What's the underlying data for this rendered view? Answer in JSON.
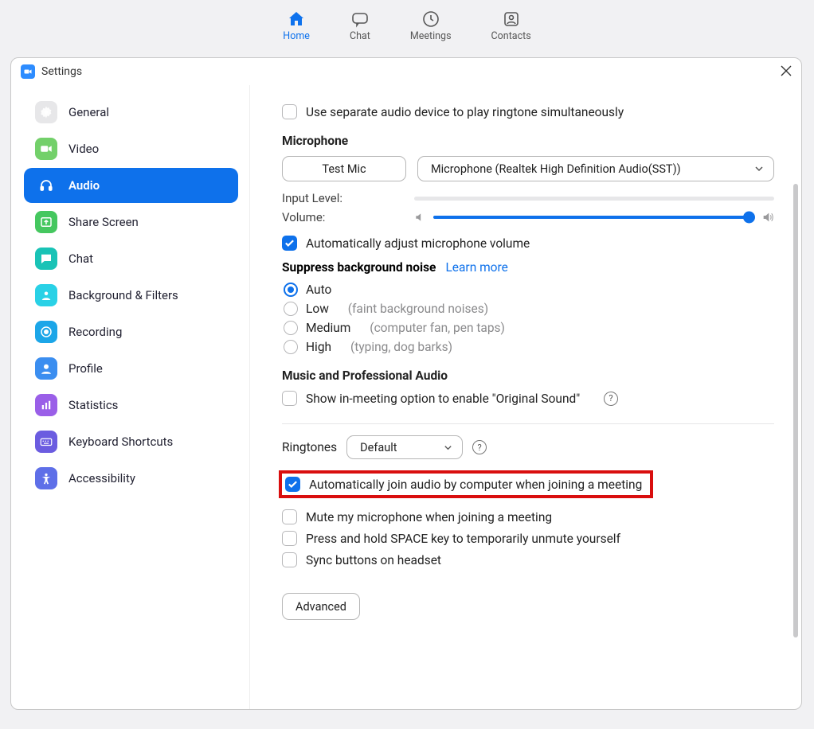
{
  "topnav": {
    "home": "Home",
    "chat": "Chat",
    "meetings": "Meetings",
    "contacts": "Contacts"
  },
  "window": {
    "title": "Settings"
  },
  "sidebar": {
    "items": [
      {
        "label": "General"
      },
      {
        "label": "Video"
      },
      {
        "label": "Audio"
      },
      {
        "label": "Share Screen"
      },
      {
        "label": "Chat"
      },
      {
        "label": "Background & Filters"
      },
      {
        "label": "Recording"
      },
      {
        "label": "Profile"
      },
      {
        "label": "Statistics"
      },
      {
        "label": "Keyboard Shortcuts"
      },
      {
        "label": "Accessibility"
      }
    ]
  },
  "audio": {
    "separate_device": "Use separate audio device to play ringtone simultaneously",
    "microphone_title": "Microphone",
    "test_mic": "Test Mic",
    "mic_device": "Microphone (Realtek High Definition Audio(SST))",
    "input_level": "Input Level:",
    "volume": "Volume:",
    "auto_adjust": "Automatically adjust microphone volume",
    "suppress_title": "Suppress background noise",
    "learn_more": "Learn more",
    "noise": {
      "auto": "Auto",
      "low": "Low",
      "low_hint": "(faint background noises)",
      "medium": "Medium",
      "medium_hint": "(computer fan, pen taps)",
      "high": "High",
      "high_hint": "(typing, dog barks)"
    },
    "music_title": "Music and Professional Audio",
    "original_sound": "Show in-meeting option to enable \"Original Sound\"",
    "ringtones_label": "Ringtones",
    "ringtone_default": "Default",
    "auto_join": "Automatically join audio by computer when joining a meeting",
    "mute_on_join": "Mute my microphone when joining a meeting",
    "space_unmute": "Press and hold SPACE key to temporarily unmute yourself",
    "sync_headset": "Sync buttons on headset",
    "advanced": "Advanced"
  }
}
